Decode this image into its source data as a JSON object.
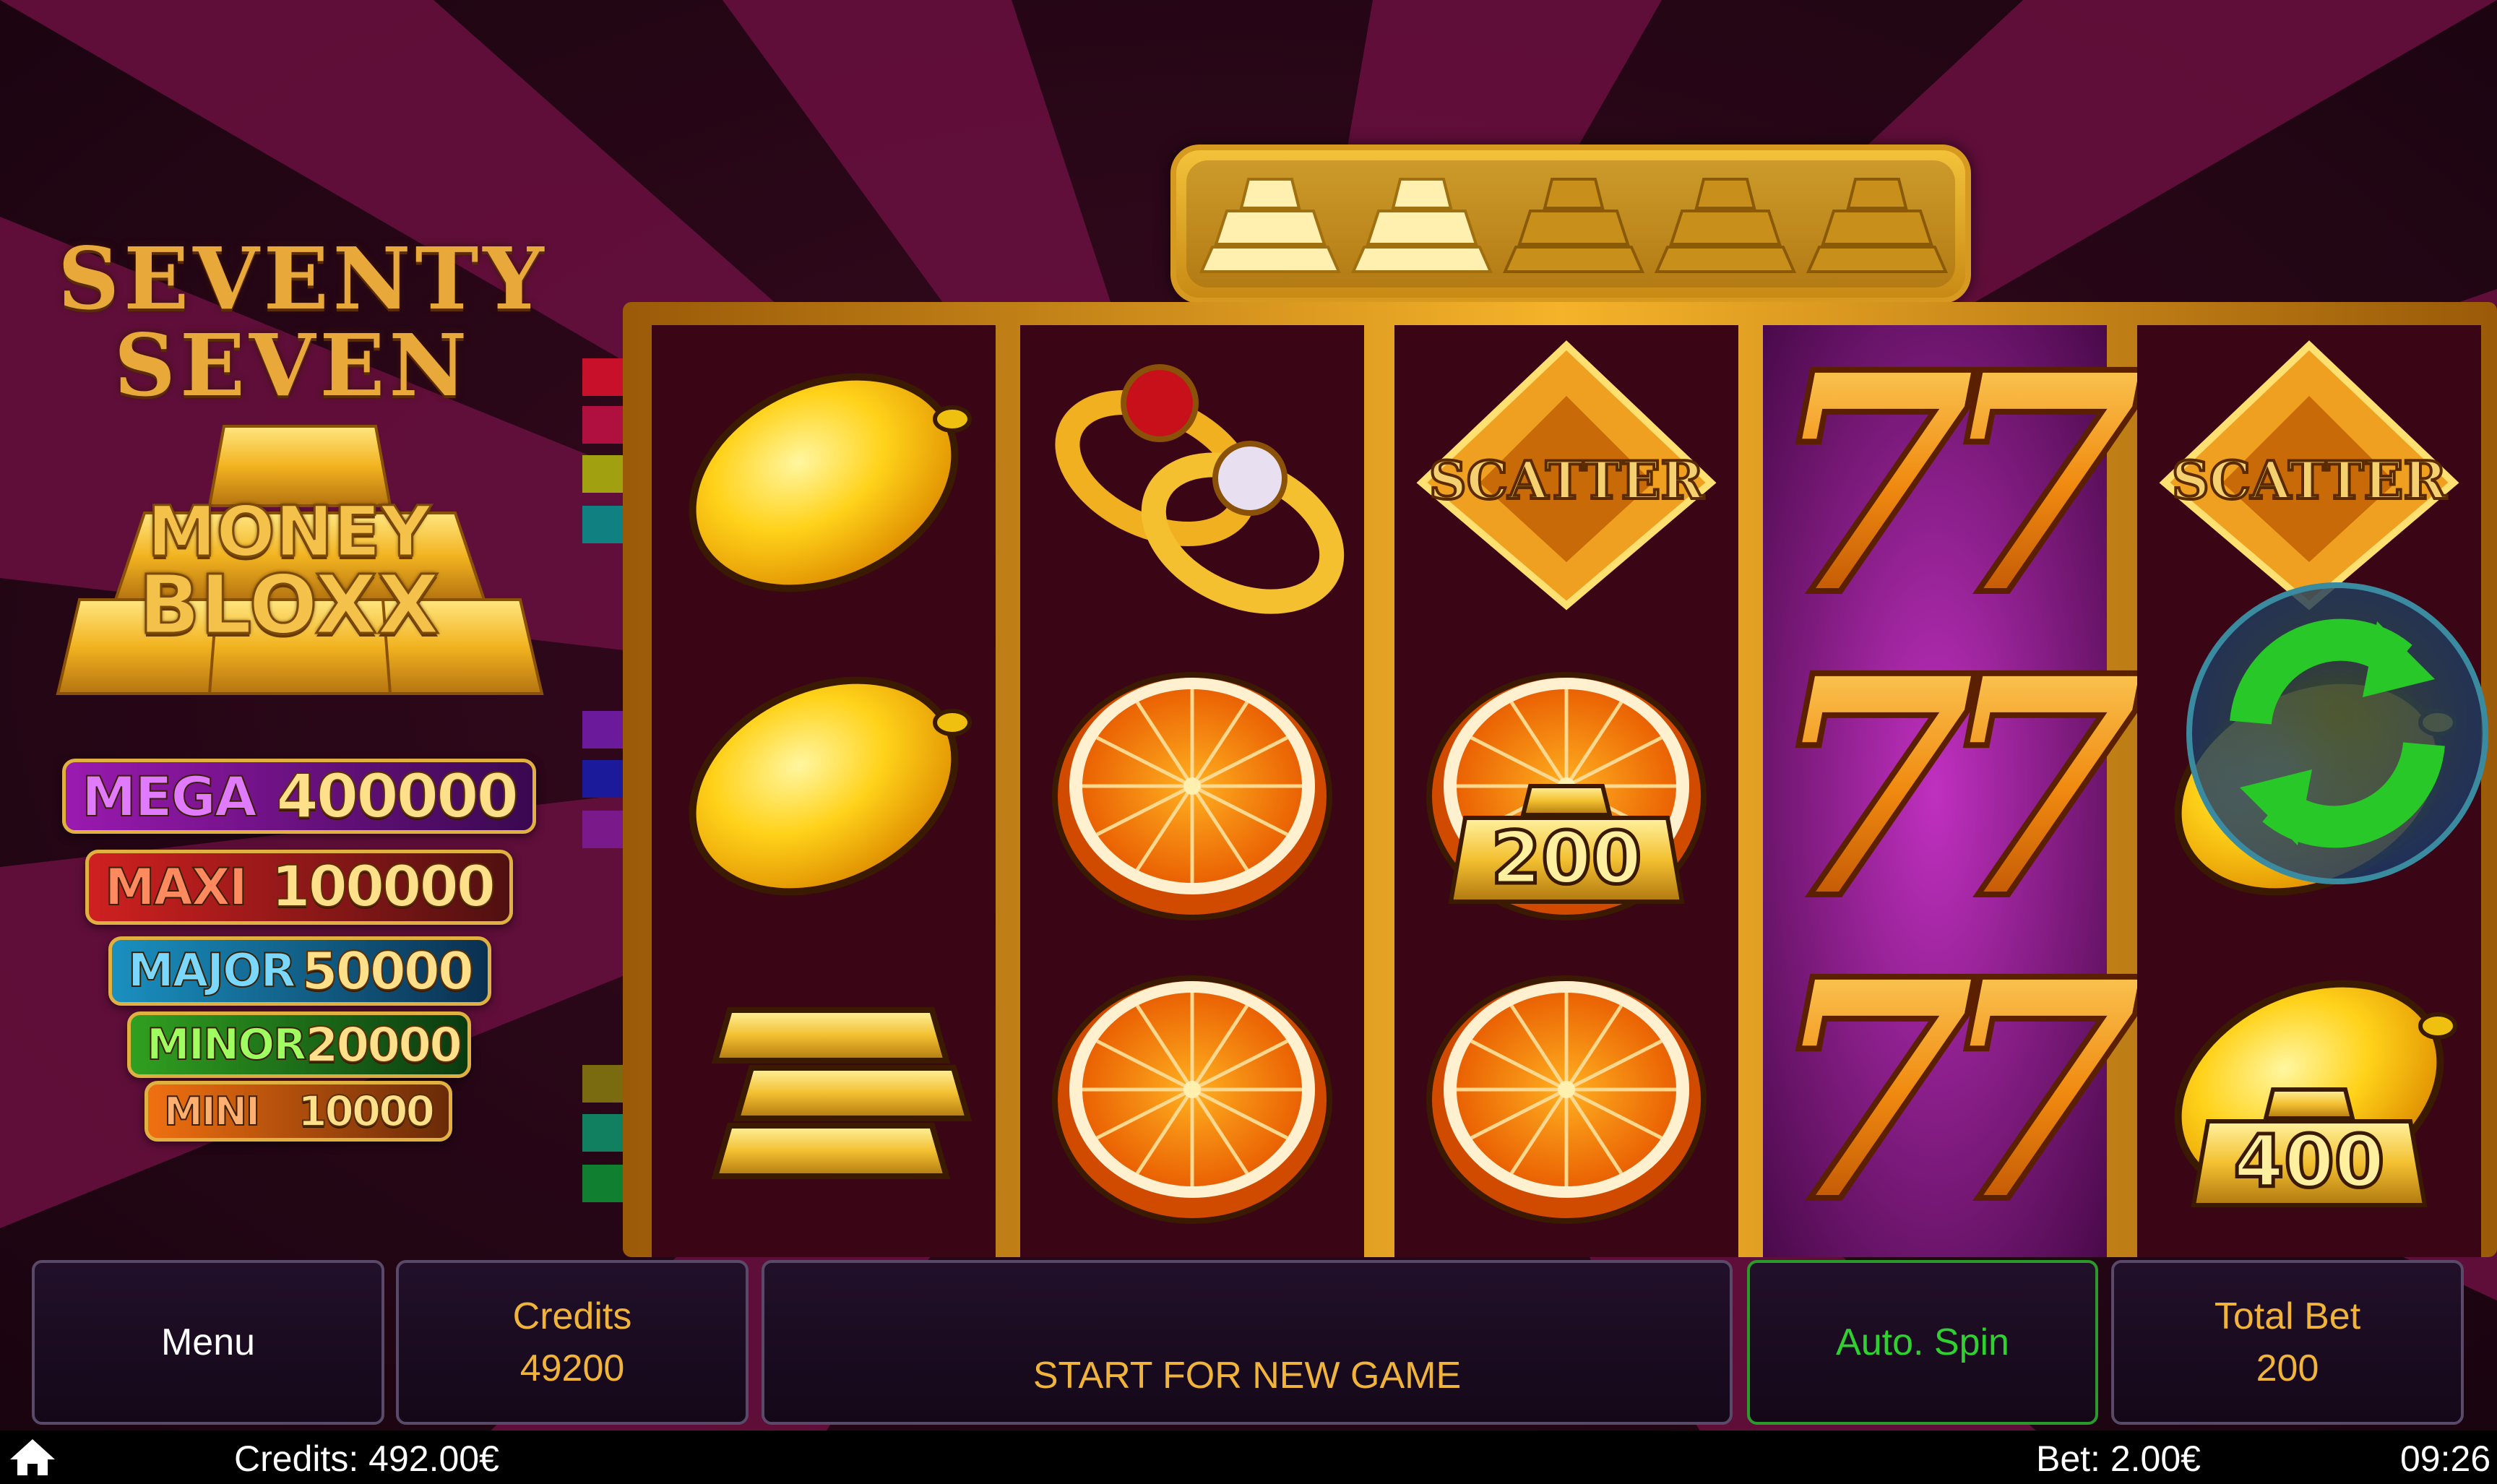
{
  "game": {
    "title_line1": "SEVENTY",
    "title_line2": "SEVEN",
    "logo_line1": "MONEY",
    "logo_line2": "BLOXX"
  },
  "jackpots": [
    {
      "label": "MEGA",
      "value": "400000",
      "color": "#8a1aa0"
    },
    {
      "label": "MAXI",
      "value": "100000",
      "color": "#c01818"
    },
    {
      "label": "MAJOR",
      "value": "50000",
      "color": "#1a7aa0"
    },
    {
      "label": "MINOR",
      "value": "20000",
      "color": "#2a8a1a"
    },
    {
      "label": "MINI",
      "value": "10000",
      "color": "#e06010"
    }
  ],
  "gold_bar_collect": {
    "filled": 2,
    "total": 5
  },
  "reels": [
    [
      "lemon",
      "lemon",
      "gold-bars"
    ],
    [
      "rings",
      "orange",
      "orange"
    ],
    [
      "scatter",
      "orange",
      "orange"
    ],
    [
      "seven",
      "seven",
      "seven"
    ],
    [
      "scatter",
      "lemon",
      "lemon"
    ]
  ],
  "symbol_labels": {
    "scatter": "SCATTER",
    "reel3_row2_bonus": "200",
    "reel5_row3_bonus": "400"
  },
  "bottom": {
    "menu_label": "Menu",
    "credits_label": "Credits",
    "credits_value": "49200",
    "message": "START FOR NEW GAME",
    "autospin_label": "Auto. Spin",
    "total_bet_label": "Total Bet",
    "total_bet_value": "200"
  },
  "status": {
    "credits": "Credits: 492.00€",
    "bet": "Bet: 2.00€",
    "time": "09:26"
  },
  "colors": {
    "accent_gold": "#f0b43a",
    "autospin_green": "#2fd12f",
    "reel_bg": "#3a0616"
  }
}
